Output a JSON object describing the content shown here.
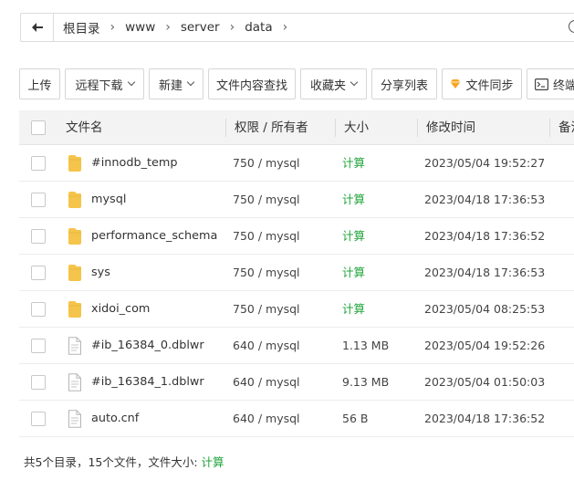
{
  "breadcrumb": [
    "根目录",
    "www",
    "server",
    "data"
  ],
  "toolbar": {
    "upload": "上传",
    "remote_download": "远程下载",
    "new": "新建",
    "search_content": "文件内容查找",
    "favorites": "收藏夹",
    "share_list": "分享列表",
    "file_sync": "文件同步",
    "terminal": "终端"
  },
  "columns": {
    "name": "文件名",
    "perm": "权限 / 所有者",
    "size": "大小",
    "mtime": "修改时间",
    "remark": "备注"
  },
  "files": [
    {
      "name": "#innodb_temp",
      "type": "folder",
      "perm": "750 / mysql",
      "size": "计算",
      "mtime": "2023/05/04 19:52:27"
    },
    {
      "name": "mysql",
      "type": "folder",
      "perm": "750 / mysql",
      "size": "计算",
      "mtime": "2023/04/18 17:36:53"
    },
    {
      "name": "performance_schema",
      "type": "folder",
      "perm": "750 / mysql",
      "size": "计算",
      "mtime": "2023/04/18 17:36:52"
    },
    {
      "name": "sys",
      "type": "folder",
      "perm": "750 / mysql",
      "size": "计算",
      "mtime": "2023/04/18 17:36:53"
    },
    {
      "name": "xidoi_com",
      "type": "folder",
      "perm": "750 / mysql",
      "size": "计算",
      "mtime": "2023/05/04 08:25:53"
    },
    {
      "name": "#ib_16384_0.dblwr",
      "type": "file",
      "perm": "640 / mysql",
      "size": "1.13 MB",
      "mtime": "2023/05/04 19:52:26"
    },
    {
      "name": "#ib_16384_1.dblwr",
      "type": "file",
      "perm": "640 / mysql",
      "size": "9.13 MB",
      "mtime": "2023/05/04 01:50:03"
    },
    {
      "name": "auto.cnf",
      "type": "file",
      "perm": "640 / mysql",
      "size": "56 B",
      "mtime": "2023/04/18 17:36:52"
    }
  ],
  "footer": {
    "summary": "共5个目录，15个文件，文件大小: ",
    "calc": "计算"
  },
  "colors": {
    "accent": "#20a53a",
    "folder": "#f5c44a"
  }
}
